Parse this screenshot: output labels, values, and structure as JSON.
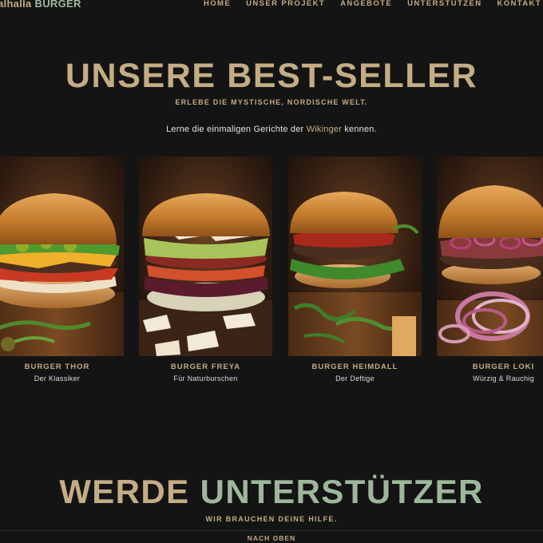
{
  "header": {
    "brand_part1": "alhalla",
    "brand_part2": "BURGER",
    "nav": [
      {
        "label": "HOME"
      },
      {
        "label": "UNSER PROJEKT"
      },
      {
        "label": "ANGEBOTE"
      },
      {
        "label": "UNTERSTÜTZEN"
      },
      {
        "label": "KONTAKT"
      }
    ]
  },
  "hero": {
    "title": "UNSERE BEST-SELLER",
    "subtitle": "ERLEBE DIE MYSTISCHE, NORDISCHE WELT.",
    "intro_before": "Lerne die einmaligen Gerichte der ",
    "intro_highlight": "Wikinger",
    "intro_after": " kennen."
  },
  "products": [
    {
      "name": "BURGER THOR",
      "desc": "Der Klassiker",
      "image": "burger-thor-photo"
    },
    {
      "name": "BURGER FREYA",
      "desc": "Für Naturburschen",
      "image": "burger-freya-photo"
    },
    {
      "name": "BURGER HEIMDALL",
      "desc": "Der Deftige",
      "image": "burger-heimdall-photo"
    },
    {
      "name": "BURGER LOKI",
      "desc": "Würzig & Rauchig",
      "image": "burger-loki-photo"
    }
  ],
  "cta": {
    "title_part1": "WERDE",
    "title_part2": "UNTERSTÜTZER",
    "subtitle": "WIR BRAUCHEN DEINE HILFE."
  },
  "footer": {
    "back_to_top": "NACH OBEN"
  },
  "colors": {
    "background": "#141414",
    "gold": "#c4ad84",
    "sage": "#9db79b",
    "text": "#e2e2e2"
  }
}
